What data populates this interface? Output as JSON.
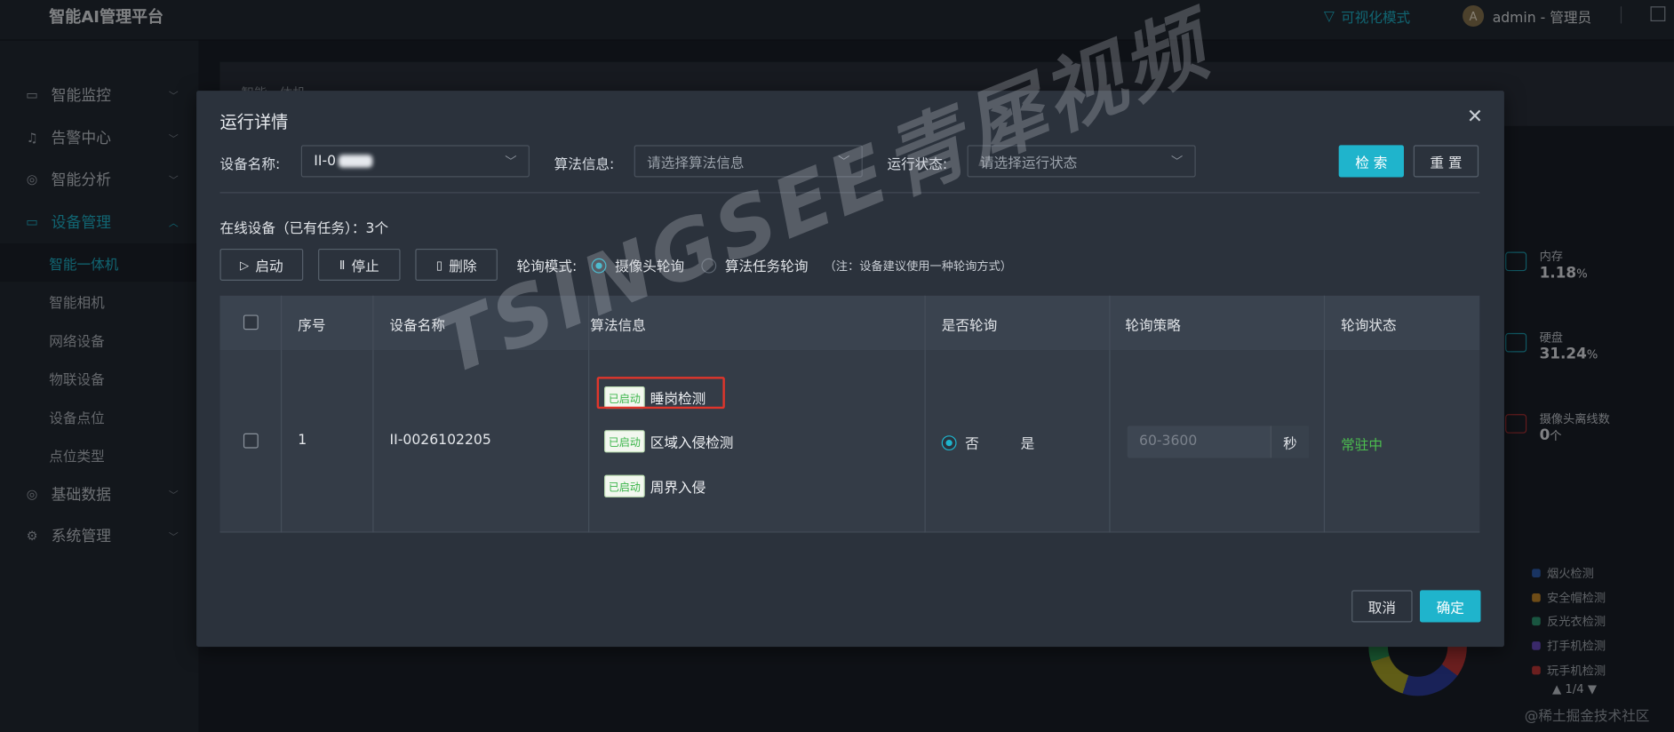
{
  "app": {
    "title": "智能AI管理平台"
  },
  "topbar": {
    "visual_mode": "可视化模式",
    "avatar_letter": "A",
    "user": "admin - 管理员"
  },
  "sidebar": {
    "menus": [
      {
        "label": "智能监控",
        "icon": "monitor-icon"
      },
      {
        "label": "告警中心",
        "icon": "bell-icon"
      },
      {
        "label": "智能分析",
        "icon": "compass-icon"
      },
      {
        "label": "设备管理",
        "icon": "video-icon"
      },
      {
        "label": "基础数据",
        "icon": "compass-icon"
      },
      {
        "label": "系统管理",
        "icon": "gear-icon"
      }
    ],
    "sub_items": [
      "智能一体机",
      "智能相机",
      "网络设备",
      "物联设备",
      "设备点位",
      "点位类型"
    ]
  },
  "background": {
    "crumb": "智能一体机",
    "stats": [
      {
        "name": "内存",
        "value": "1.18",
        "unit": "%"
      },
      {
        "name": "硬盘",
        "value": "31.24",
        "unit": "%"
      },
      {
        "name": "摄像头离线数",
        "value": "0",
        "unit": "个"
      }
    ],
    "legend": [
      {
        "label": "烟火检测",
        "color": "#2f5fb3"
      },
      {
        "label": "安全帽检测",
        "color": "#c98a2b"
      },
      {
        "label": "反光衣检测",
        "color": "#2f9c75"
      },
      {
        "label": "打手机检测",
        "color": "#6a4cc2"
      },
      {
        "label": "玩手机检测",
        "color": "#c53a3a"
      }
    ],
    "pager": "1/4",
    "corner_watermark": "@稀土掘金技术社区"
  },
  "modal": {
    "title": "运行详情",
    "filters": {
      "device_label": "设备名称:",
      "device_value": "II-0",
      "algo_label": "算法信息:",
      "algo_placeholder": "请选择算法信息",
      "status_label": "运行状态:",
      "status_placeholder": "请选择运行状态",
      "search": "检 索",
      "reset": "重 置"
    },
    "online_text": "在线设备（已有任务）：3个",
    "actions": {
      "start": "启动",
      "stop": "停止",
      "delete": "删除"
    },
    "poll_mode_label": "轮询模式:",
    "poll_options": [
      "摄像头轮询",
      "算法任务轮询"
    ],
    "poll_note": "（注：设备建议使用一种轮询方式）",
    "table": {
      "headers": [
        "序号",
        "设备名称",
        "算法信息",
        "是否轮询",
        "轮询策略",
        "轮询状态"
      ],
      "row": {
        "index": "1",
        "device": "II-0026102205",
        "tag": "已启动",
        "algorithms": [
          "睡岗检测",
          "区域入侵检测",
          "周界入侵"
        ],
        "poll_no": "否",
        "poll_yes": "是",
        "range_placeholder": "60-3600",
        "unit": "秒",
        "status": "常驻中"
      }
    },
    "footer": {
      "cancel": "取消",
      "confirm": "确定"
    },
    "watermark": "TSINGSEE青犀视频"
  }
}
